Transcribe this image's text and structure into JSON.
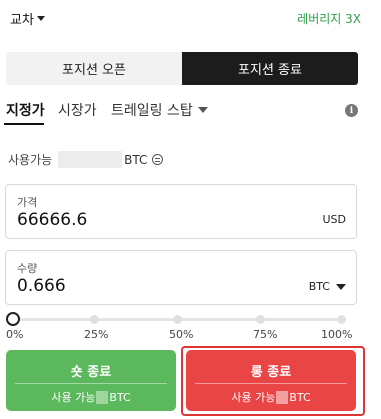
{
  "topbar": {
    "margin_mode": "교차",
    "leverage": "레버리지 3X",
    "leverage_color": "#2e9e4a"
  },
  "position_tabs": {
    "open": "포지션 오픈",
    "close": "포지션 종료",
    "active": "close"
  },
  "order_tabs": {
    "limit": "지정가",
    "market": "시장가",
    "trailing": "트레일링 스탑",
    "active": "limit",
    "info_icon": "info-icon"
  },
  "available": {
    "label": "사용가능",
    "unit": "BTC",
    "icon": "swap-icon"
  },
  "price": {
    "label": "가격",
    "value": "66666.6",
    "unit": "USD"
  },
  "quantity": {
    "label": "수량",
    "value": "0.666",
    "unit": "BTC"
  },
  "slider": {
    "labels": [
      "0%",
      "25%",
      "50%",
      "75%",
      "100%"
    ],
    "value_percent": 0
  },
  "buttons": {
    "short": {
      "title": "숏 종료",
      "sub_prefix": "사용 가능",
      "sub_unit": "BTC",
      "color": "#5bb85d"
    },
    "long": {
      "title": "롱 종료",
      "sub_prefix": "사용 가능",
      "sub_unit": "BTC",
      "color": "#ea4545"
    }
  }
}
